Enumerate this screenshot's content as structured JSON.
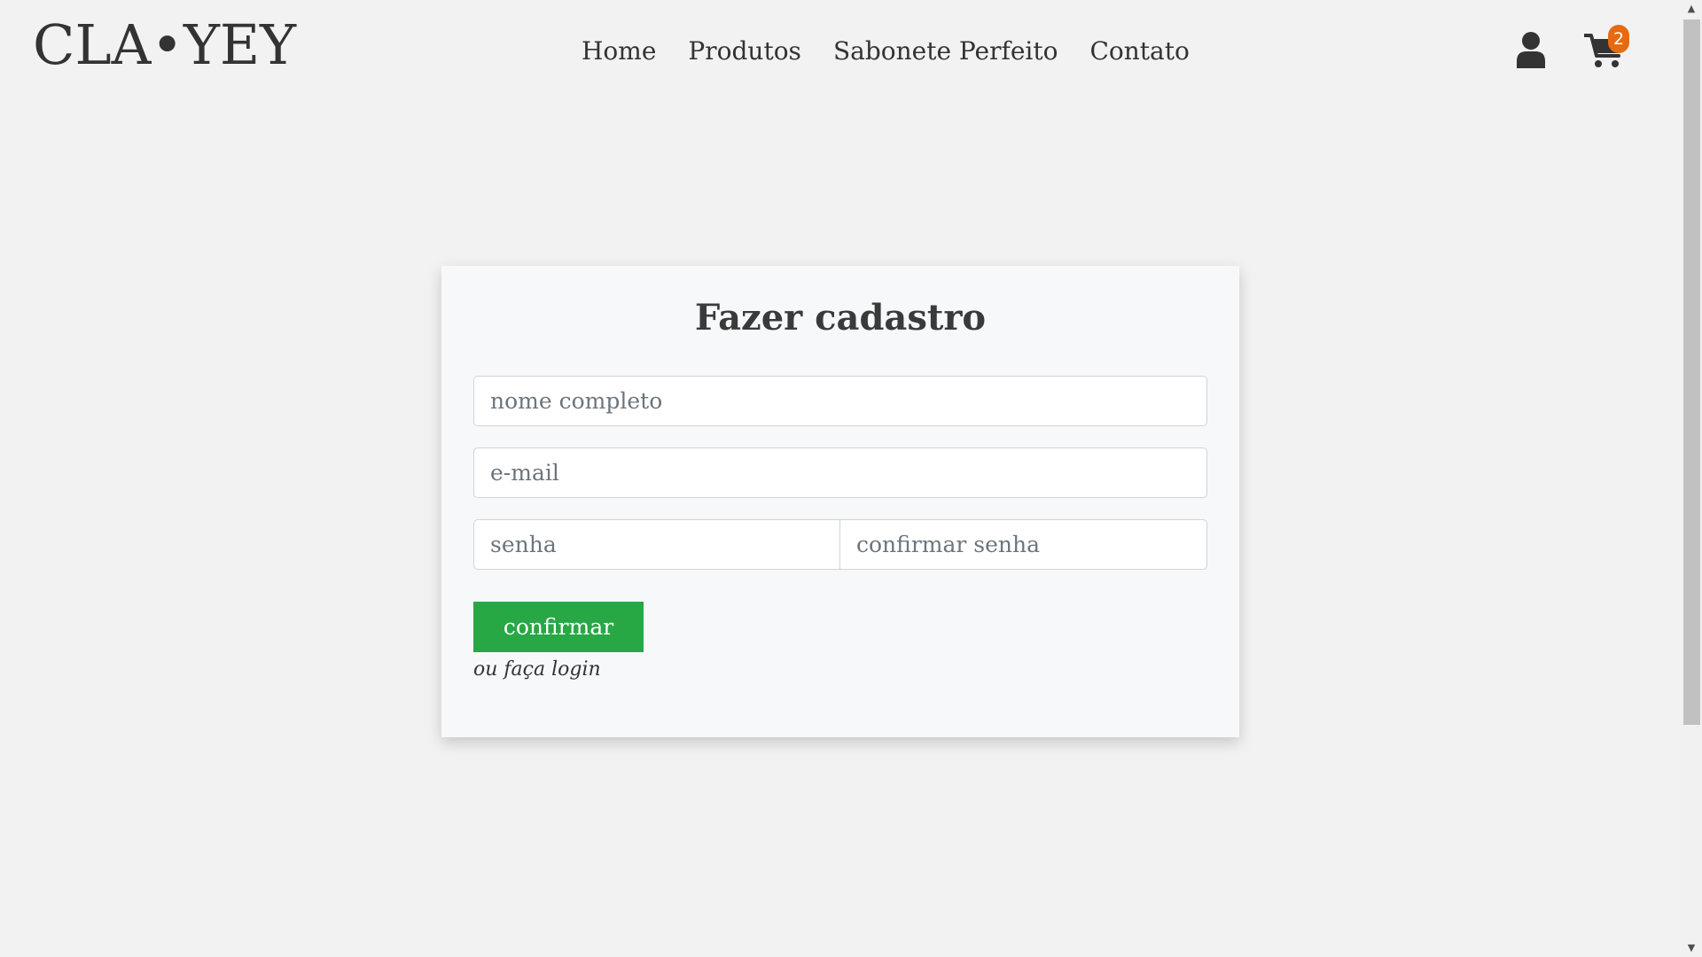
{
  "header": {
    "logo": "CLA•YEY",
    "nav": [
      {
        "label": "Home"
      },
      {
        "label": "Produtos"
      },
      {
        "label": "Sabonete Perfeito"
      },
      {
        "label": "Contato"
      }
    ],
    "icons": {
      "user": "user-icon",
      "cart": "shopping-cart-icon"
    },
    "cart_count": "2"
  },
  "form": {
    "title": "Fazer cadastro",
    "fields": {
      "name": {
        "value": "",
        "placeholder": "nome completo"
      },
      "email": {
        "value": "",
        "placeholder": "e-mail"
      },
      "password": {
        "value": "",
        "placeholder": "senha"
      },
      "confirm_password": {
        "value": "",
        "placeholder": "confirmar senha"
      }
    },
    "submit_label": "confirmar",
    "login_link": "ou faça login"
  },
  "colors": {
    "background": "#f2f2f2",
    "card": "#f7f8fa",
    "submit": "#28a745",
    "badge": "#e76a10",
    "text": "#333333"
  }
}
